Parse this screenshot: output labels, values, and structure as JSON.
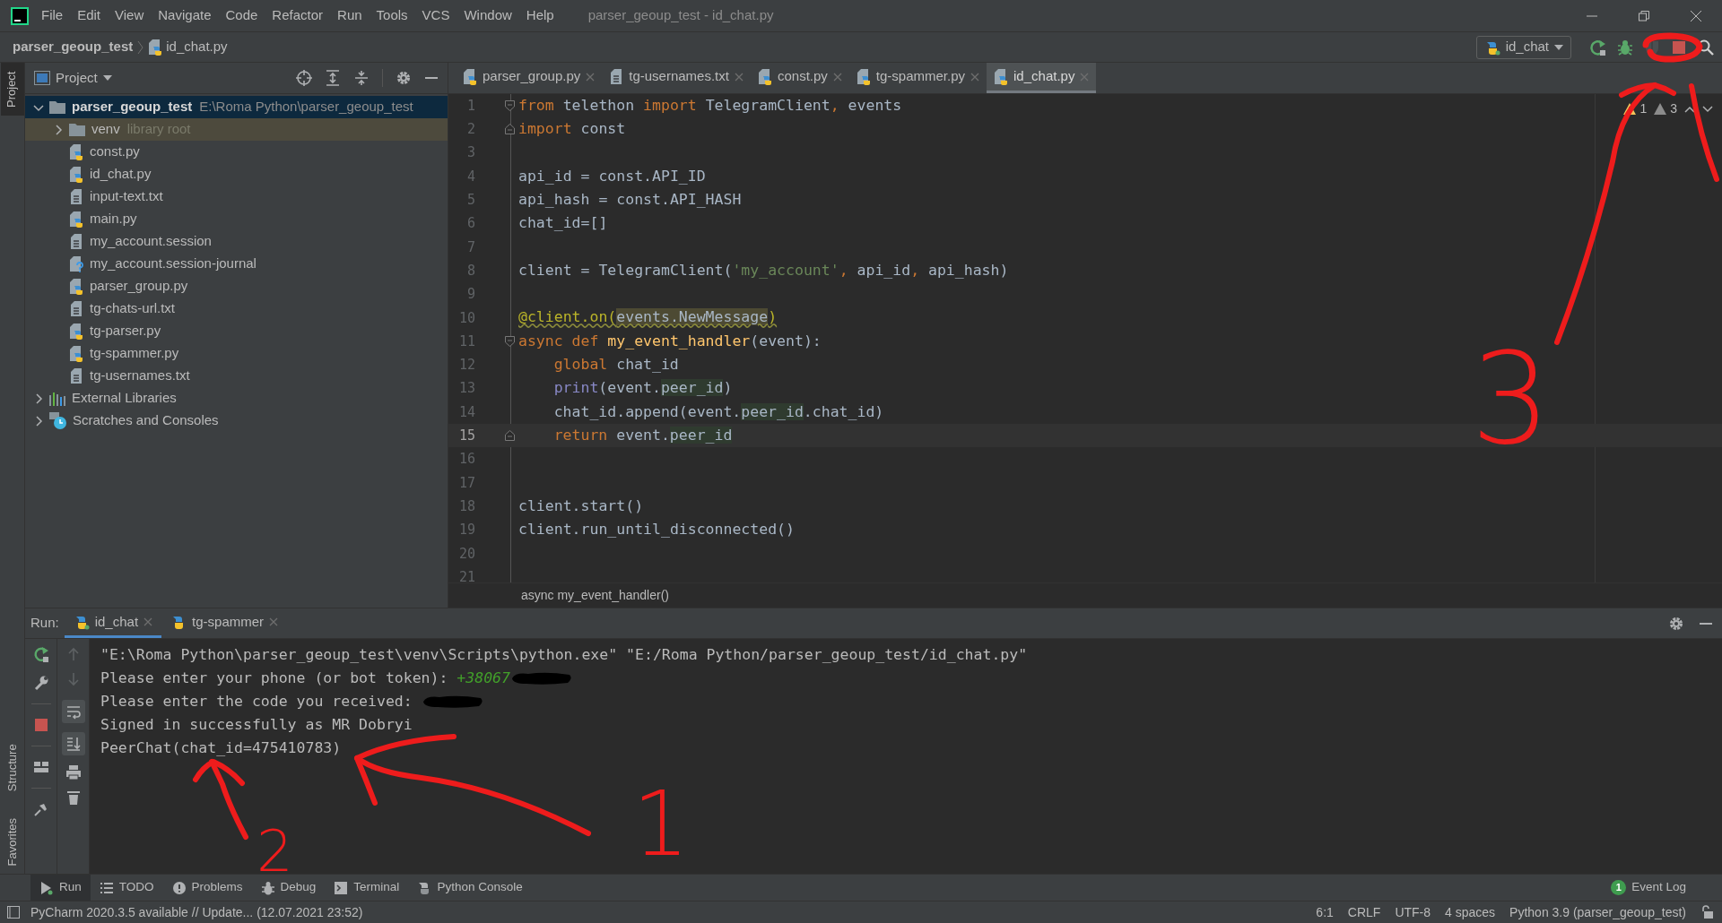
{
  "title_bar": {
    "menu": [
      "File",
      "Edit",
      "View",
      "Navigate",
      "Code",
      "Refactor",
      "Run",
      "Tools",
      "VCS",
      "Window",
      "Help"
    ],
    "title": "parser_geoup_test - id_chat.py"
  },
  "nav_bar": {
    "breadcrumbs": [
      {
        "text": "parser_geoup_test",
        "kind": "project"
      },
      {
        "text": "id_chat.py",
        "kind": "py"
      }
    ],
    "run_config": "id_chat"
  },
  "side_tabs": [
    {
      "label": "Project",
      "selected": true
    },
    {
      "label": "Structure",
      "selected": false
    },
    {
      "label": "Favorites",
      "selected": false
    }
  ],
  "project": {
    "title": "Project",
    "tree": [
      {
        "name": "parser_geoup_test",
        "hint": "E:\\Roma Python\\parser_geoup_test",
        "kind": "folder",
        "expanded": true,
        "selected": true,
        "children": [
          {
            "name": "venv",
            "hint": "library root",
            "kind": "library",
            "expanded": false,
            "selected": false
          },
          {
            "name": "const.py",
            "kind": "py",
            "selected": false
          },
          {
            "name": "id_chat.py",
            "kind": "py",
            "selected": false
          },
          {
            "name": "input-text.txt",
            "kind": "txt",
            "selected": false
          },
          {
            "name": "main.py",
            "kind": "py",
            "selected": false
          },
          {
            "name": "my_account.session",
            "kind": "txt",
            "selected": false
          },
          {
            "name": "my_account.session-journal",
            "kind": "unknown",
            "selected": false
          },
          {
            "name": "parser_group.py",
            "kind": "py",
            "selected": false
          },
          {
            "name": "tg-chats-url.txt",
            "kind": "txt",
            "selected": false
          },
          {
            "name": "tg-parser.py",
            "kind": "py",
            "selected": false
          },
          {
            "name": "tg-spammer.py",
            "kind": "py",
            "selected": false
          },
          {
            "name": "tg-usernames.txt",
            "kind": "txt",
            "selected": false
          }
        ]
      },
      {
        "name": "External Libraries",
        "kind": "libs",
        "expanded": false,
        "selected": false
      },
      {
        "name": "Scratches and Consoles",
        "kind": "scratch",
        "expanded": false,
        "selected": false
      }
    ]
  },
  "editor": {
    "tabs": [
      {
        "label": "parser_group.py",
        "kind": "py",
        "selected": false
      },
      {
        "label": "tg-usernames.txt",
        "kind": "txt",
        "selected": false
      },
      {
        "label": "const.py",
        "kind": "py",
        "selected": false
      },
      {
        "label": "tg-spammer.py",
        "kind": "py",
        "selected": false
      },
      {
        "label": "id_chat.py",
        "kind": "py",
        "selected": true
      }
    ],
    "inspections": {
      "warnings": "1",
      "weak_warnings": "3"
    },
    "lines": [
      {
        "number": "1",
        "fold_start": true,
        "current": false,
        "tokens": [
          {
            "kind": "keyword",
            "text": "from "
          },
          {
            "kind": "plain",
            "text": "telethon "
          },
          {
            "kind": "keyword",
            "text": "import "
          },
          {
            "kind": "plain",
            "text": "TelegramClient"
          },
          {
            "kind": "keyword",
            "text": ", "
          },
          {
            "kind": "plain",
            "text": "events"
          }
        ]
      },
      {
        "number": "2",
        "fold_end": true,
        "current": false,
        "tokens": [
          {
            "kind": "keyword",
            "text": "import "
          },
          {
            "kind": "plain",
            "text": "const"
          }
        ]
      },
      {
        "number": "3",
        "current": false
      },
      {
        "number": "4",
        "current": false,
        "tokens": [
          {
            "kind": "plain",
            "text": "api_id = const.API_ID"
          }
        ]
      },
      {
        "number": "5",
        "current": false,
        "tokens": [
          {
            "kind": "plain",
            "text": "api_hash = const.API_HASH"
          }
        ]
      },
      {
        "number": "6",
        "current": false,
        "tokens": [
          {
            "kind": "plain",
            "text": "chat_id=[]"
          }
        ]
      },
      {
        "number": "7",
        "current": false
      },
      {
        "number": "8",
        "current": false,
        "tokens": [
          {
            "kind": "plain",
            "text": "client = TelegramClient("
          },
          {
            "kind": "string",
            "text": "'my_account'"
          },
          {
            "kind": "keyword",
            "text": ", "
          },
          {
            "kind": "plain",
            "text": "api_id"
          },
          {
            "kind": "keyword",
            "text": ", "
          },
          {
            "kind": "plain",
            "text": "api_hash)"
          }
        ]
      },
      {
        "number": "9",
        "current": false
      },
      {
        "number": "10",
        "current": false,
        "tokens": [
          {
            "kind": "decorator",
            "text": "@client.on("
          },
          {
            "kind": "decorator-arg",
            "text": "events.NewMessage"
          },
          {
            "kind": "decorator",
            "text": ")"
          }
        ]
      },
      {
        "number": "11",
        "fold_start": true,
        "current": false,
        "tokens": [
          {
            "kind": "keyword",
            "text": "async def "
          },
          {
            "kind": "function",
            "text": "my_event_handler"
          },
          {
            "kind": "plain",
            "text": "(event):"
          }
        ]
      },
      {
        "number": "12",
        "current": false,
        "indented": true,
        "tokens": [
          {
            "kind": "keyword",
            "text": "global "
          },
          {
            "kind": "plain",
            "text": "chat_id"
          }
        ]
      },
      {
        "number": "13",
        "current": false,
        "indented": true,
        "tokens": [
          {
            "kind": "builtin",
            "text": "print"
          },
          {
            "kind": "plain",
            "text": "(event."
          },
          {
            "kind": "reference",
            "text": "peer_id"
          },
          {
            "kind": "plain",
            "text": ")"
          }
        ]
      },
      {
        "number": "14",
        "current": false,
        "indented": true,
        "tokens": [
          {
            "kind": "plain",
            "text": "chat_id.append(event."
          },
          {
            "kind": "reference",
            "text": "peer_id"
          },
          {
            "kind": "plain",
            "text": ".chat_id)"
          }
        ]
      },
      {
        "number": "15",
        "fold_end": true,
        "current": true,
        "indented": true,
        "tokens": [
          {
            "kind": "keyword",
            "text": "return "
          },
          {
            "kind": "plain",
            "text": "event."
          },
          {
            "kind": "reference",
            "text": "peer_id"
          }
        ]
      },
      {
        "number": "16",
        "current": false
      },
      {
        "number": "17",
        "current": false
      },
      {
        "number": "18",
        "current": false,
        "tokens": [
          {
            "kind": "plain",
            "text": "client.start()"
          }
        ]
      },
      {
        "number": "19",
        "current": false,
        "tokens": [
          {
            "kind": "plain",
            "text": "client.run_until_disconnected()"
          }
        ]
      },
      {
        "number": "20",
        "current": false
      },
      {
        "number": "21",
        "current": false
      }
    ],
    "breadcrumb": "async my_event_handler()"
  },
  "run": {
    "label": "Run:",
    "tabs": [
      {
        "label": "id_chat",
        "selected": true
      },
      {
        "label": "tg-spammer",
        "selected": false
      }
    ],
    "console": [
      [
        {
          "kind": "output",
          "text": "\"E:\\Roma Python\\parser_geoup_test\\venv\\Scripts\\python.exe\" \"E:/Roma Python/parser_geoup_test/id_chat.py\""
        }
      ],
      [
        {
          "kind": "output",
          "text": "Please enter your phone (or bot token): "
        },
        {
          "kind": "input",
          "text": "+38067"
        },
        {
          "kind": "redacted"
        }
      ],
      [
        {
          "kind": "output",
          "text": "Please enter the code you received: "
        },
        {
          "kind": "redacted"
        }
      ],
      [
        {
          "kind": "output",
          "text": "Signed in successfully as MR Dobryi"
        }
      ],
      [
        {
          "kind": "output",
          "text": "PeerChat(chat_id=475410783)"
        }
      ]
    ]
  },
  "tool_windows": [
    {
      "label": "Run",
      "kind": "run",
      "selected": true
    },
    {
      "label": "TODO",
      "kind": "todo",
      "selected": false
    },
    {
      "label": "Problems",
      "kind": "problems",
      "selected": false
    },
    {
      "label": "Debug",
      "kind": "debug",
      "selected": false
    },
    {
      "label": "Terminal",
      "kind": "terminal",
      "selected": false
    },
    {
      "label": "Python Console",
      "kind": "console",
      "selected": false
    }
  ],
  "event_log": {
    "label": "Event Log",
    "count": "1"
  },
  "status_bar": {
    "message": "PyCharm 2020.3.5 available // Update... (12.07.2021 23:52)",
    "items": [
      "6:1",
      "CRLF",
      "UTF-8",
      "4 spaces",
      "Python 3.9 (parser_geoup_test)"
    ]
  },
  "annotations": [
    {
      "label": "1"
    },
    {
      "label": "2"
    },
    {
      "label": "3"
    }
  ]
}
